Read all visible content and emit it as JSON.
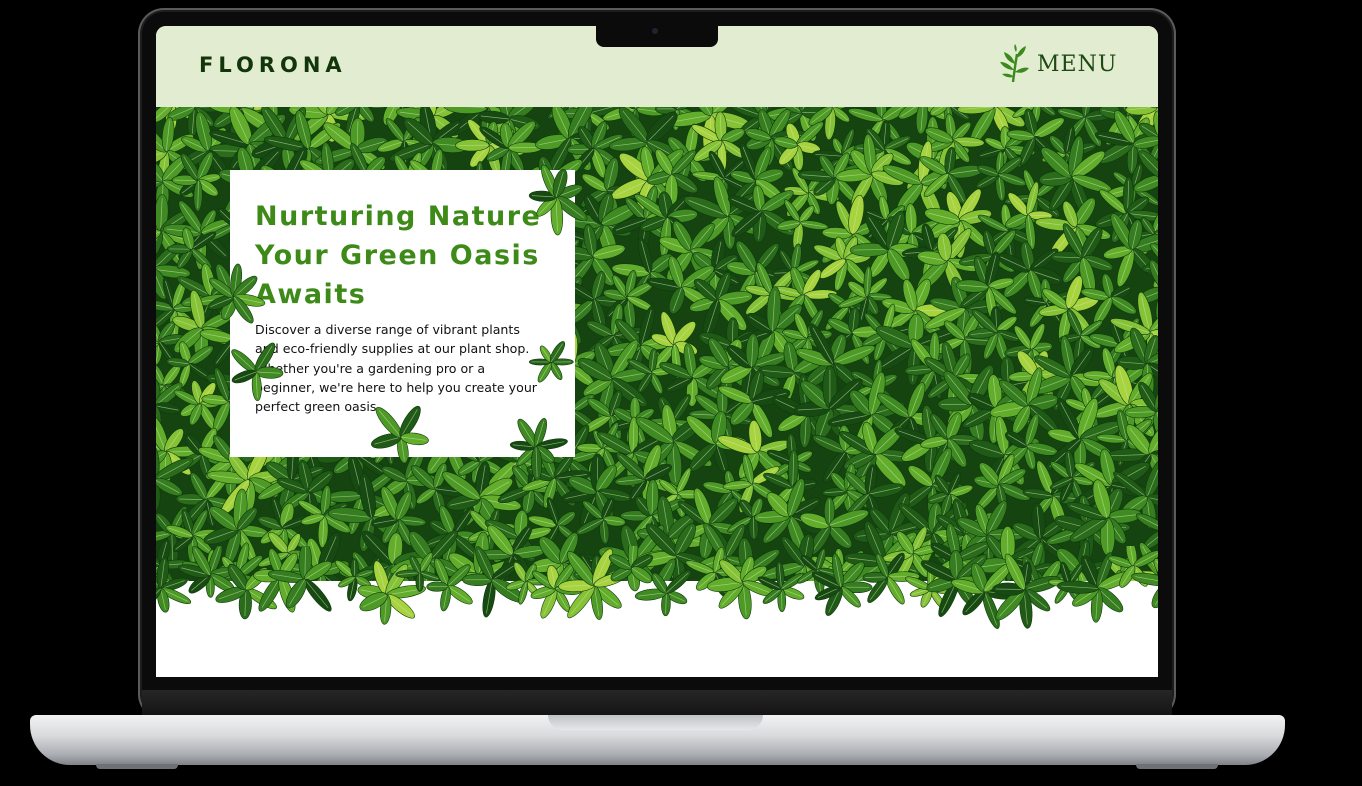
{
  "site": {
    "brand": "FLORONA",
    "menu_label": "MENU",
    "menu_icon": "herb-sprig-icon"
  },
  "hero": {
    "title_lines": [
      "Nurturing Nature",
      "Your Green Oasis",
      "Awaits"
    ],
    "description_lines": [
      "Discover a diverse range of vibrant plants",
      "and eco-friendly supplies at our plant shop.",
      "Whether you're a gardening pro or a",
      "beginner, we're here to help you create your",
      "perfect green oasis."
    ],
    "background_image": "green-foliage-photo"
  },
  "colors": {
    "header_bg": "#e1ecd0",
    "brand_text": "#12350b",
    "title_green": "#3d8a18",
    "leaf_dark": "#1f5a16",
    "leaf_mid": "#3f8a22",
    "leaf_light": "#a7d33e"
  }
}
